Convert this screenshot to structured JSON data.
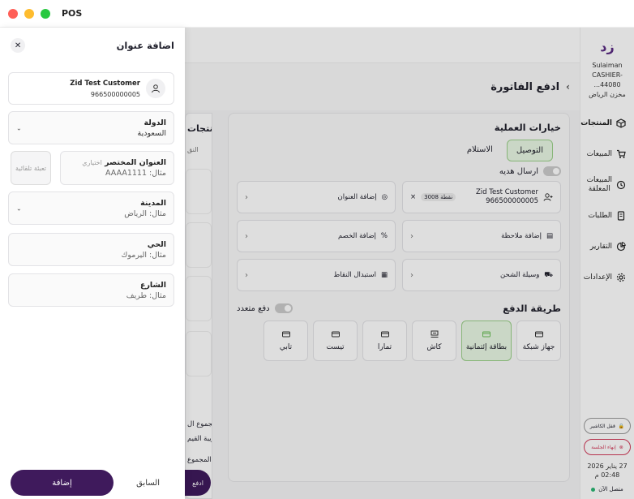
{
  "window": {
    "title": "POS"
  },
  "app_nav": {
    "logo": "زد",
    "user_name": "Sulaiman",
    "cashier": "CASHIER-44080...",
    "store": "مخزن الرياض",
    "items": [
      {
        "label": "المنتجات",
        "icon": "box-icon"
      },
      {
        "label": "المبيعات",
        "icon": "cart-icon"
      },
      {
        "label": "المبيعات المعلقة",
        "icon": "history-icon"
      },
      {
        "label": "الطلبات",
        "icon": "receipt-icon"
      },
      {
        "label": "التقارير",
        "icon": "chart-icon"
      },
      {
        "label": "الإعدادات",
        "icon": "gear-icon"
      }
    ],
    "lock_label": "قفل الكاشير",
    "end_session_label": "إنهاء الجلسة",
    "date": "27 يناير 2026",
    "time": "02:48 م",
    "status": "متصل الآن"
  },
  "invoice": {
    "title": "ادفع الفاتورة",
    "options_title": "خيارات العملية",
    "delivery_tabs": [
      "التوصيل",
      "الاستلام"
    ],
    "gift_label": "ارسال هديه",
    "customer_name": "Zid Test Customer",
    "customer_phone": "966500000005",
    "points_badge": "نقطة 3008",
    "add_address": "إضافة العنوان",
    "add_note": "إضافة ملاحظة",
    "add_discount": "إضافة الخصم",
    "shipping": "وسيلة الشحن",
    "redeem_points": "استبدال النقاط",
    "payment_title": "طريقة الدفع",
    "multi_pay_label": "دفع متعدد",
    "payment_methods": [
      "جهاز شبكة",
      "بطاقة إئتمانية",
      "كاش",
      "تمارا",
      "تيست",
      "تابي"
    ]
  },
  "products": {
    "title": "منتجات",
    "ai_label": "النق",
    "subtotal": "المجموع ال",
    "tax": "ضريبة القيم",
    "total": "المجموع",
    "pay_button": "ادفع"
  },
  "drawer": {
    "title": "اضافة عنوان",
    "customer_name": "Zid Test Customer",
    "customer_phone": "966500000005",
    "country_label": "الدولة",
    "country_value": "السعودية",
    "short_label": "العنوان المختصر",
    "optional": "اختياري",
    "short_placeholder": "مثال: AAAA1111",
    "autofill": "تعبئة تلقائية",
    "city_label": "المدينة",
    "city_placeholder": "مثال: الرياض",
    "district_label": "الحي",
    "district_placeholder": "مثال: اليرموك",
    "street_label": "الشارع",
    "street_placeholder": "مثال: طريف",
    "prev_button": "السابق",
    "add_button": "إضافة"
  }
}
